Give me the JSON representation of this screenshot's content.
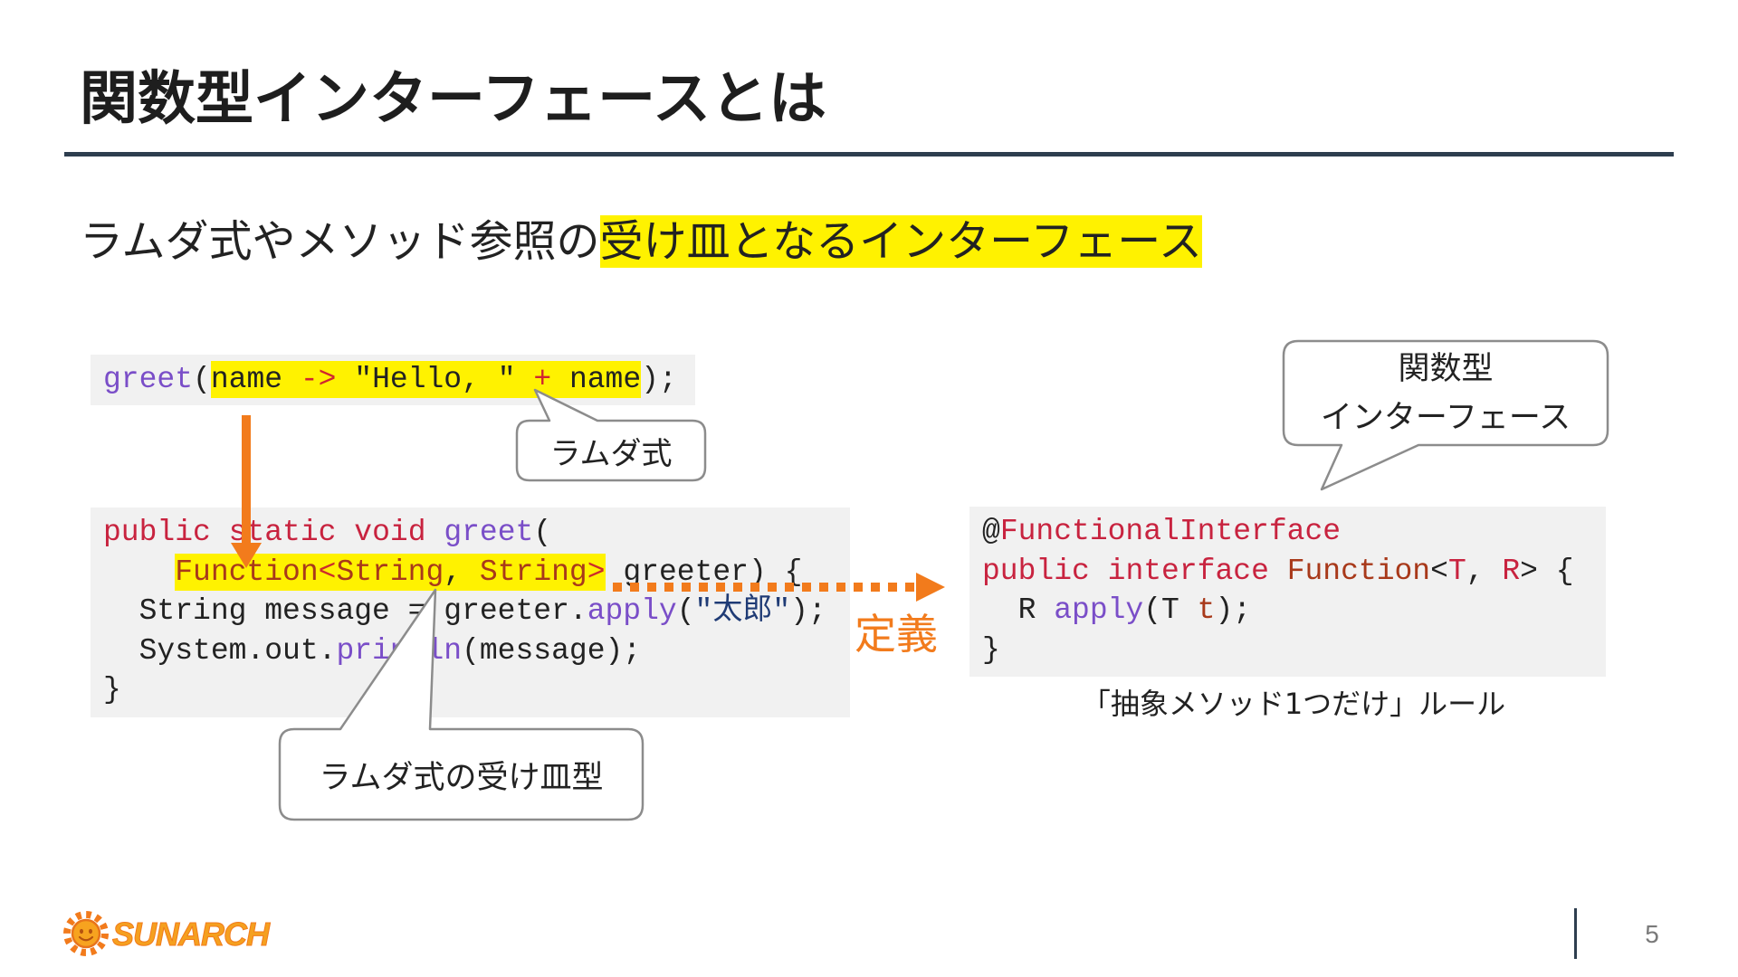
{
  "slide": {
    "title": "関数型インターフェースとは",
    "subtitle_plain": "ラムダ式やメソッド参照の",
    "subtitle_highlight": "受け皿となるインターフェース",
    "page_number": "5"
  },
  "code": {
    "greet_call": [
      [
        {
          "t": "greet",
          "c": "#7a4ec8"
        },
        {
          "t": "("
        },
        {
          "t": "name ",
          "hl": true
        },
        {
          "t": "->",
          "c": "#d0262f",
          "hl": true
        },
        {
          "t": " \"Hello, \" ",
          "hl": true
        },
        {
          "t": "+",
          "c": "#d0262f",
          "hl": true
        },
        {
          "t": " name",
          "hl": true
        },
        {
          "t": ");"
        }
      ]
    ],
    "greet_method": [
      [
        {
          "t": "public",
          "c": "#c8233f"
        },
        {
          "t": " "
        },
        {
          "t": "static",
          "c": "#c8233f"
        },
        {
          "t": " "
        },
        {
          "t": "void",
          "c": "#c8233f"
        },
        {
          "t": " "
        },
        {
          "t": "greet",
          "c": "#7a4ec8"
        },
        {
          "t": "("
        }
      ],
      [
        {
          "t": "    "
        },
        {
          "t": "Function",
          "c": "#a8391a",
          "hl": true
        },
        {
          "t": "<",
          "c": "#cc2b2b",
          "hl": true
        },
        {
          "t": "String",
          "c": "#a8391a",
          "hl": true
        },
        {
          "t": ", ",
          "hl": true
        },
        {
          "t": "String",
          "c": "#a8391a",
          "hl": true
        },
        {
          "t": ">",
          "c": "#cc2b2b",
          "hl": true
        },
        {
          "t": " greeter) {"
        }
      ],
      [
        {
          "t": "  String message = greeter."
        },
        {
          "t": "apply",
          "c": "#7a4ec8"
        },
        {
          "t": "("
        },
        {
          "t": "\"太郎\"",
          "c": "#1f3b75"
        },
        {
          "t": ");"
        }
      ],
      [
        {
          "t": "  System.out."
        },
        {
          "t": "println",
          "c": "#7a4ec8"
        },
        {
          "t": "(message);"
        }
      ],
      [
        {
          "t": "}"
        }
      ]
    ],
    "function_interface": [
      [
        {
          "t": "@"
        },
        {
          "t": "FunctionalInterface",
          "c": "#c8233f"
        }
      ],
      [
        {
          "t": "public",
          "c": "#c8233f"
        },
        {
          "t": " "
        },
        {
          "t": "interface",
          "c": "#c8233f"
        },
        {
          "t": " "
        },
        {
          "t": "Function",
          "c": "#a8391a"
        },
        {
          "t": "<"
        },
        {
          "t": "T",
          "c": "#c8233f"
        },
        {
          "t": ", "
        },
        {
          "t": "R",
          "c": "#c8233f"
        },
        {
          "t": "> {"
        }
      ],
      [
        {
          "t": "  R "
        },
        {
          "t": "apply",
          "c": "#7a4ec8"
        },
        {
          "t": "(T "
        },
        {
          "t": "t",
          "c": "#a8391a"
        },
        {
          "t": ");"
        }
      ],
      [
        {
          "t": "}"
        }
      ]
    ]
  },
  "callouts": {
    "lambda": "ラムダ式",
    "lambda_receiver_type": "ラムダ式の受け皿型",
    "functional_interface": [
      "関数型",
      "インターフェース"
    ]
  },
  "definition_label": "定義",
  "rule_caption": "「抽象メソッド1つだけ」ルール",
  "logo": {
    "text": "SUNARCH",
    "icon": "sun-logo-icon"
  },
  "colors": {
    "accent_orange": "#f27b1c",
    "highlight_yellow": "#fff200",
    "title_rule": "#2e3e4f",
    "code_bg": "#f1f1f1",
    "callout_border": "#8c8c8c",
    "logo_orange": "#f5a01f",
    "page_number": "#7a7a7a"
  }
}
